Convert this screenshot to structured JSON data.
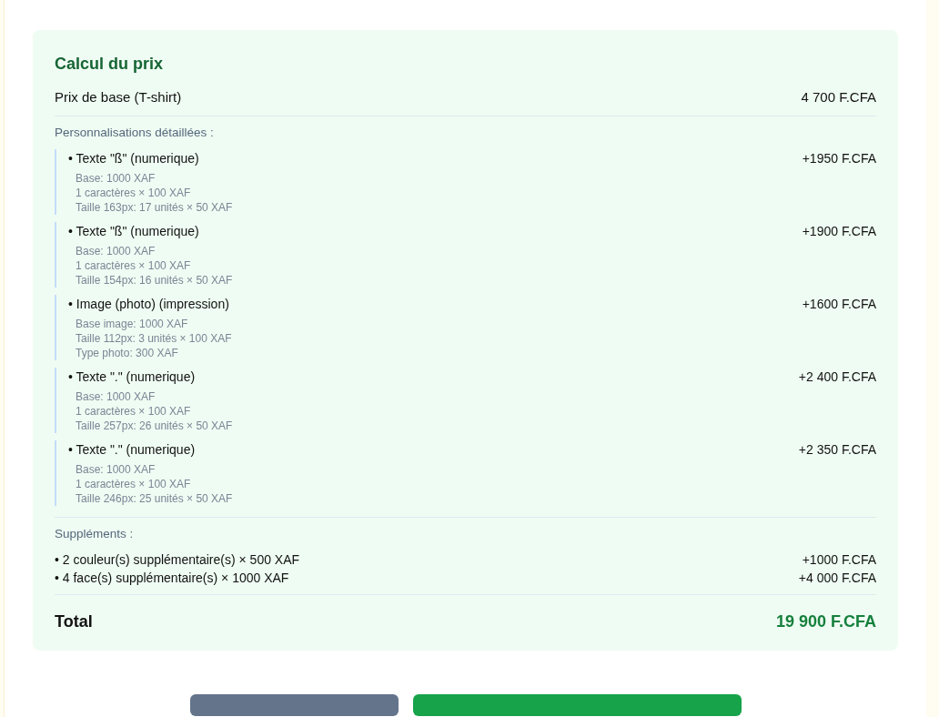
{
  "price_card": {
    "title": "Calcul du prix",
    "base": {
      "label": "Prix de base (T-shirt)",
      "amount": "4 700 F.CFA"
    },
    "customizations_heading": "Personnalisations détaillées :",
    "customizations": [
      {
        "label": "• Texte \"ß\" (numerique)",
        "amount": "+1950 F.CFA",
        "details": [
          "Base: 1000 XAF",
          "1 caractères × 100 XAF",
          "Taille 163px: 17 unités × 50 XAF"
        ]
      },
      {
        "label": "• Texte \"ß\" (numerique)",
        "amount": "+1900 F.CFA",
        "details": [
          "Base: 1000 XAF",
          "1 caractères × 100 XAF",
          "Taille 154px: 16 unités × 50 XAF"
        ]
      },
      {
        "label": "• Image (photo) (impression)",
        "amount": "+1600 F.CFA",
        "details": [
          "Base image: 1000 XAF",
          "Taille 112px: 3 unités × 100 XAF",
          "Type photo: 300 XAF"
        ]
      },
      {
        "label": "• Texte \".\" (numerique)",
        "amount": "+2 400 F.CFA",
        "details": [
          "Base: 1000 XAF",
          "1 caractères × 100 XAF",
          "Taille 257px: 26 unités × 50 XAF"
        ]
      },
      {
        "label": "• Texte \".\" (numerique)",
        "amount": "+2 350 F.CFA",
        "details": [
          "Base: 1000 XAF",
          "1 caractères × 100 XAF",
          "Taille 246px: 25 unités × 50 XAF"
        ]
      }
    ],
    "supplements_heading": "Suppléments :",
    "supplements": [
      {
        "label": "• 2 couleur(s) supplémentaire(s) × 500 XAF",
        "amount": "+1000 F.CFA"
      },
      {
        "label": "• 4 face(s) supplémentaire(s) × 1000 XAF",
        "amount": "+4 000 F.CFA"
      }
    ],
    "total": {
      "label": "Total",
      "amount": "19 900 F.CFA"
    }
  },
  "buttons": [
    {
      "kind": "secondary"
    },
    {
      "kind": "primary"
    }
  ]
}
